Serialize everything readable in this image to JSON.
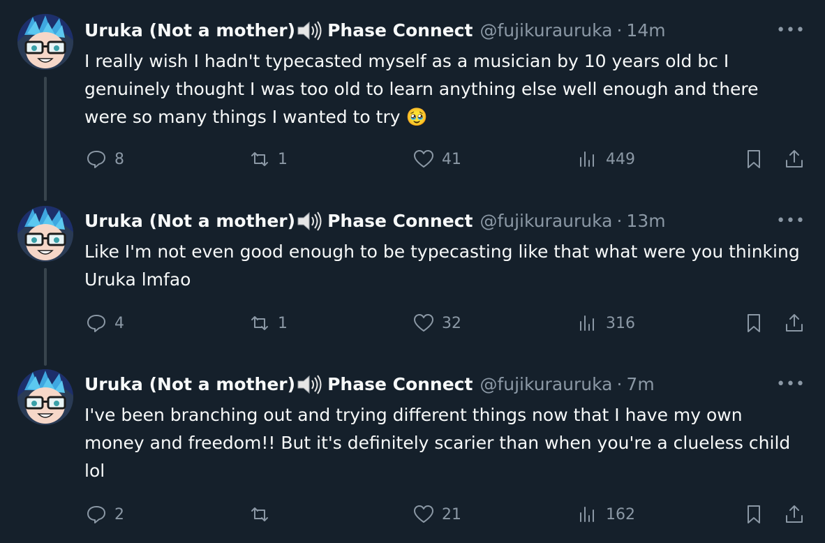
{
  "tweets": [
    {
      "display_name": "Uruka (Not a mother)",
      "org": "Phase Connect",
      "handle": "@fujikurauruka",
      "separator": "·",
      "time": "14m",
      "text": "I really wish I hadn't typecasted myself as a musician by 10 years old bc I genuinely thought I was too old to learn anything else well enough and there were so many things I wanted to try 🥹",
      "replies": "8",
      "retweets": "1",
      "likes": "41",
      "views": "449"
    },
    {
      "display_name": "Uruka (Not a mother)",
      "org": "Phase Connect",
      "handle": "@fujikurauruka",
      "separator": "·",
      "time": "13m",
      "text": "Like I'm not even good enough to be typecasting like that what were you thinking Uruka lmfao",
      "replies": "4",
      "retweets": "1",
      "likes": "32",
      "views": "316"
    },
    {
      "display_name": "Uruka (Not a mother)",
      "org": "Phase Connect",
      "handle": "@fujikurauruka",
      "separator": "·",
      "time": "7m",
      "text": "I've been branching out and trying different things now that I have my own money and freedom!! But it's definitely scarier than when you're a clueless child lol",
      "replies": "2",
      "retweets": "",
      "likes": "21",
      "views": "162"
    }
  ],
  "more_label": "•••",
  "colors": {
    "background": "#15202b",
    "text": "#f7f9f9",
    "muted": "#8b98a5",
    "thread_line": "#38444d"
  },
  "icons": [
    "reply-icon",
    "retweet-icon",
    "heart-icon",
    "views-icon",
    "bookmark-icon",
    "share-icon",
    "speaker-icon",
    "more-icon"
  ]
}
